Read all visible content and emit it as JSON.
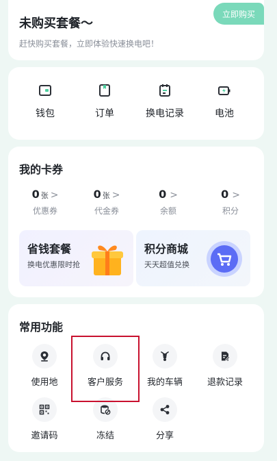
{
  "package": {
    "title": "未购买套餐～",
    "subtitle": "赶快购买套餐，立即体验快速换电吧！",
    "buy_label": "立即购买"
  },
  "quick_menu": [
    {
      "label": "钱包",
      "icon": "wallet-icon"
    },
    {
      "label": "订单",
      "icon": "order-icon"
    },
    {
      "label": "换电记录",
      "icon": "swap-record-icon"
    },
    {
      "label": "电池",
      "icon": "battery-icon"
    }
  ],
  "coupons": {
    "title": "我的卡券",
    "stats": [
      {
        "value": "0",
        "unit": "张",
        "label": "优惠券"
      },
      {
        "value": "0",
        "unit": "张",
        "label": "代金券"
      },
      {
        "value": "0",
        "unit": "",
        "label": "余额"
      },
      {
        "value": "0",
        "unit": "",
        "label": "积分"
      }
    ],
    "promos": [
      {
        "title": "省钱套餐",
        "subtitle": "换电优惠限时抢",
        "icon": "gift-icon"
      },
      {
        "title": "积分商城",
        "subtitle": "天天超值兑换",
        "icon": "shopping-cart-icon"
      }
    ]
  },
  "functions": {
    "title": "常用功能",
    "items": [
      {
        "label": "使用地",
        "icon": "location-pin-icon"
      },
      {
        "label": "客户服务",
        "icon": "headphones-icon"
      },
      {
        "label": "我的车辆",
        "icon": "scooter-icon"
      },
      {
        "label": "退款记录",
        "icon": "refund-record-icon"
      },
      {
        "label": "邀请码",
        "icon": "qr-code-icon"
      },
      {
        "label": "冻结",
        "icon": "freeze-icon"
      },
      {
        "label": "分享",
        "icon": "share-icon"
      }
    ]
  },
  "colors": {
    "accent": "#7ad9ba",
    "icon_dark": "#2b2f36",
    "highlight": "#c8102e",
    "background": "#eef7f4"
  }
}
